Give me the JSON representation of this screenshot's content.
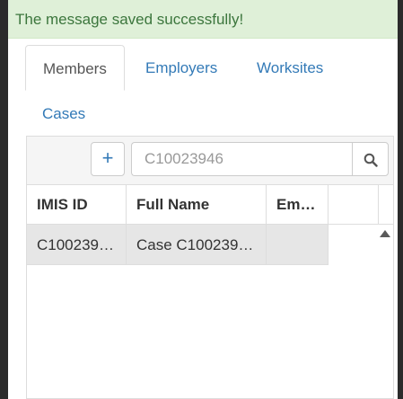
{
  "alert": {
    "message": "The message saved successfully!"
  },
  "tabs": [
    {
      "label": "Members",
      "active": true
    },
    {
      "label": "Employers",
      "active": false
    },
    {
      "label": "Worksites",
      "active": false
    },
    {
      "label": "Cases",
      "active": false
    }
  ],
  "toolbar": {
    "add_label": "+",
    "search_value": "C10023946",
    "search_icon": "search-icon"
  },
  "table": {
    "columns": [
      "IMIS ID",
      "Full Name",
      "Em…"
    ],
    "rows": [
      [
        "C100239…",
        "Case C100239…",
        ""
      ]
    ]
  },
  "colors": {
    "alert_bg": "#dff0d8",
    "alert_text": "#3c763d",
    "link": "#337ab7",
    "selected_row": "#e6e6e6"
  }
}
